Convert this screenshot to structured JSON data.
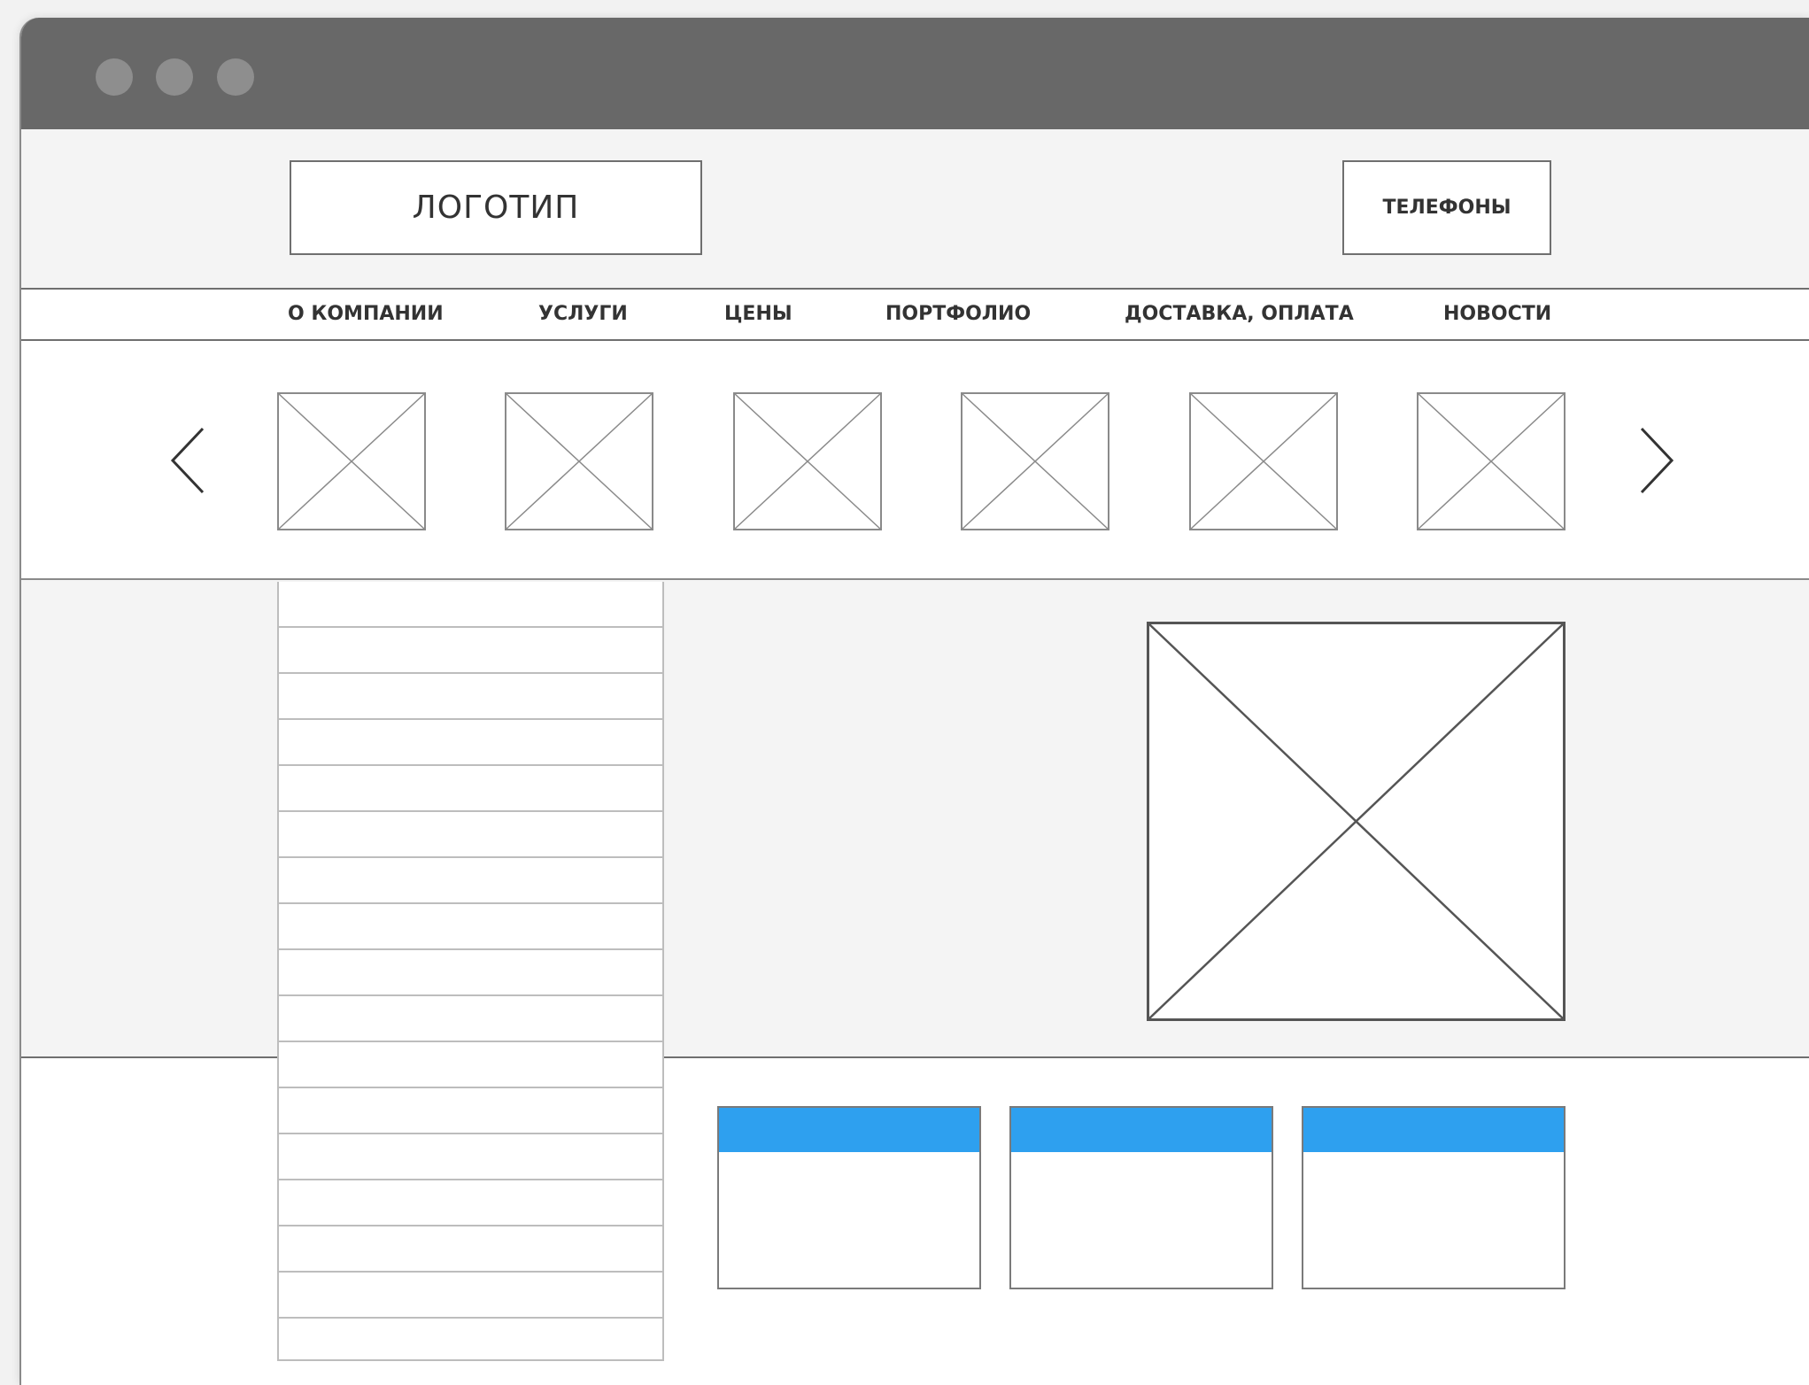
{
  "window": {
    "traffic_lights": [
      "close",
      "minimize",
      "maximize"
    ],
    "titlebar_color": "#686868"
  },
  "header": {
    "logo_label": "ЛОГОТИП",
    "phones_label": "ТЕЛЕФОНЫ"
  },
  "nav": {
    "items": [
      {
        "label": "О КОМПАНИИ"
      },
      {
        "label": "УСЛУГИ"
      },
      {
        "label": "ЦЕНЫ"
      },
      {
        "label": "ПОРТФОЛИО"
      },
      {
        "label": "ДОСТАВКА, ОПЛАТА"
      },
      {
        "label": "НОВОСТИ"
      }
    ]
  },
  "carousel": {
    "prev_icon": "chevron-left-icon",
    "next_icon": "chevron-right-icon",
    "thumbnail_count": 6
  },
  "sidebar": {
    "row_count": 17
  },
  "main": {
    "image_placeholder": "image-placeholder-icon"
  },
  "cards": {
    "count": 3,
    "header_color": "#2ea0ef"
  }
}
